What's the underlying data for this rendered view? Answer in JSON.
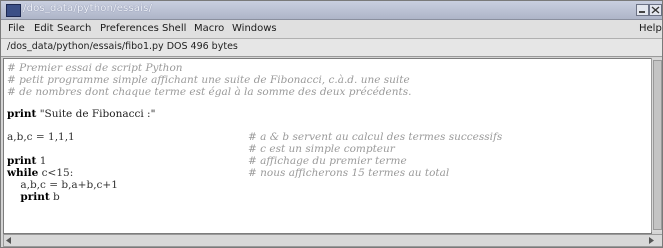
{
  "window": {
    "title": "/dos_data/python/essais/"
  },
  "menu": {
    "items": [
      "File",
      "Edit",
      "Search",
      "Preferences",
      "Shell",
      "Macro",
      "Windows"
    ],
    "help": "Help"
  },
  "statusbar": {
    "path": "/dos_data/python/essais/fibo1.py DOS 496 bytes"
  },
  "code": {
    "comment1": "# Premier essai de script Python",
    "comment2": "# petit programme simple affichant une suite de Fibonacci, c.à.d. une suite",
    "comment3": "# de nombres dont chaque terme est égal à la somme des deux précédents.",
    "print_kw": "print",
    "print_str": " \"Suite de Fibonacci :\"",
    "assign1": "a,b,c = 1,1,1",
    "cmt_a": "# a & b servent au calcul des termes successifs",
    "cmt_b": "# c est un simple compteur",
    "print1_kw": "print",
    "print1_val": " 1",
    "cmt_c": "# affichage du premier terme",
    "while_kw": "while",
    "while_cond": " c<15:",
    "cmt_d": "# nous afficherons 15 termes au total",
    "assign2": "    a,b,c = b,a+b,c+1",
    "print2_indent": "    ",
    "print2_kw": "print",
    "print2_val": " b"
  }
}
